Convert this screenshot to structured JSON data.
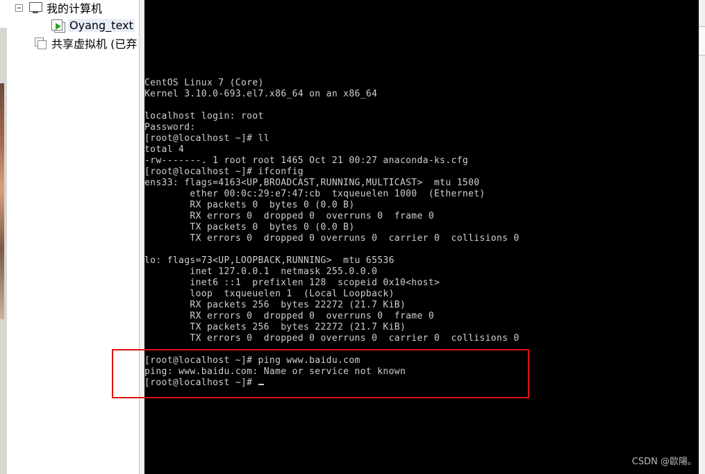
{
  "tree": {
    "root_label": "我的计算机",
    "vm_label": "Oyang_text",
    "shared_label": "共享虚拟机 (已弃"
  },
  "terminal": {
    "lines": [
      "CentOS Linux 7 (Core)",
      "Kernel 3.10.0-693.el7.x86_64 on an x86_64",
      "",
      "localhost login: root",
      "Password:",
      "[root@localhost ~]# ll",
      "total 4",
      "-rw-------. 1 root root 1465 Oct 21 00:27 anaconda-ks.cfg",
      "[root@localhost ~]# ifconfig",
      "ens33: flags=4163<UP,BROADCAST,RUNNING,MULTICAST>  mtu 1500",
      "        ether 00:0c:29:e7:47:cb  txqueuelen 1000  (Ethernet)",
      "        RX packets 0  bytes 0 (0.0 B)",
      "        RX errors 0  dropped 0  overruns 0  frame 0",
      "        TX packets 0  bytes 0 (0.0 B)",
      "        TX errors 0  dropped 0 overruns 0  carrier 0  collisions 0",
      "",
      "lo: flags=73<UP,LOOPBACK,RUNNING>  mtu 65536",
      "        inet 127.0.0.1  netmask 255.0.0.0",
      "        inet6 ::1  prefixlen 128  scopeid 0x10<host>",
      "        loop  txqueuelen 1  (Local Loopback)",
      "        RX packets 256  bytes 22272 (21.7 KiB)",
      "        RX errors 0  dropped 0  overruns 0  frame 0",
      "        TX packets 256  bytes 22272 (21.7 KiB)",
      "        TX errors 0  dropped 0 overruns 0  carrier 0  collisions 0",
      "",
      "[root@localhost ~]# ping www.baidu.com",
      "ping: www.baidu.com: Name or service not known",
      "[root@localhost ~]# "
    ]
  },
  "watermark": "CSDN @歐陽。",
  "colors": {
    "terminal_bg": "#000000",
    "terminal_fg": "#d0d0d0",
    "highlight_border": "#e01010",
    "vm_play_icon": "#2aa52a"
  }
}
